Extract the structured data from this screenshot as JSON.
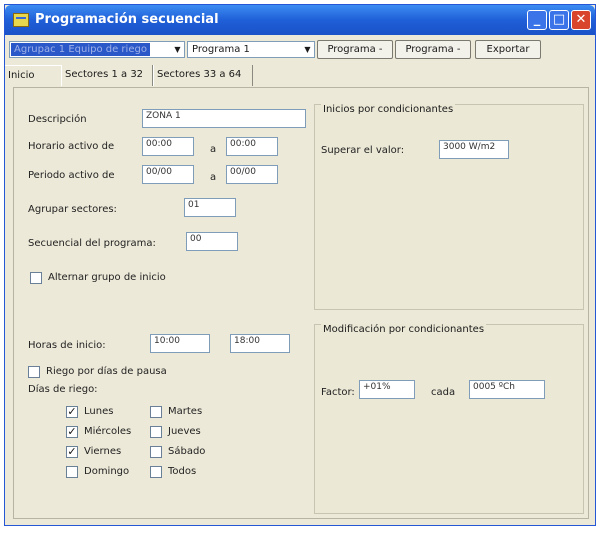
{
  "window": {
    "title": "Programación secuencial",
    "minimize_glyph": "_",
    "maximize_glyph": "□",
    "close_glyph": "✕"
  },
  "toolbar": {
    "group_select": "Agrupac 1 Equipo de riego",
    "program_select": "Programa 1",
    "btn_prev": "Programa -",
    "btn_next": "Programa -",
    "btn_export": "Exportar"
  },
  "tabs": [
    "Inicio",
    "Sectores 1 a 32",
    "Sectores 33 a 64"
  ],
  "inicio": {
    "descripcion_label": "Descripción",
    "descripcion_value": "ZONA 1",
    "horario_label": "Horario activo de",
    "horario_from": "00:00",
    "a_label": "a",
    "horario_to": "00:00",
    "periodo_label": "Periodo activo de",
    "periodo_from": "00/00",
    "periodo_to": "00/00",
    "agrupar_label": "Agrupar sectores:",
    "agrupar_value": "01",
    "secuencial_label": "Secuencial del programa:",
    "secuencial_value": "00",
    "alternar_label": "Alternar grupo de inicio",
    "horas_label": "Horas de inicio:",
    "hora1": "10:00",
    "hora2": "18:00",
    "riego_pausa_label": "Riego por días de pausa",
    "dias_label": "Días de riego:",
    "days": [
      {
        "label": "Lunes",
        "checked": true
      },
      {
        "label": "Martes",
        "checked": false
      },
      {
        "label": "Miércoles",
        "checked": true
      },
      {
        "label": "Jueves",
        "checked": false
      },
      {
        "label": "Viernes",
        "checked": true
      },
      {
        "label": "Sábado",
        "checked": false
      },
      {
        "label": "Domingo",
        "checked": false
      },
      {
        "label": "Todos",
        "checked": false
      }
    ]
  },
  "inicios_cond": {
    "title": "Inicios por condicionantes",
    "superar_label": "Superar el valor:",
    "superar_value": "3000 W/m2"
  },
  "modif_cond": {
    "title": "Modificación por condicionantes",
    "factor_label": "Factor:",
    "factor_value": "+01%",
    "cada_label": "cada",
    "cada_value": "0005 ºCh"
  }
}
